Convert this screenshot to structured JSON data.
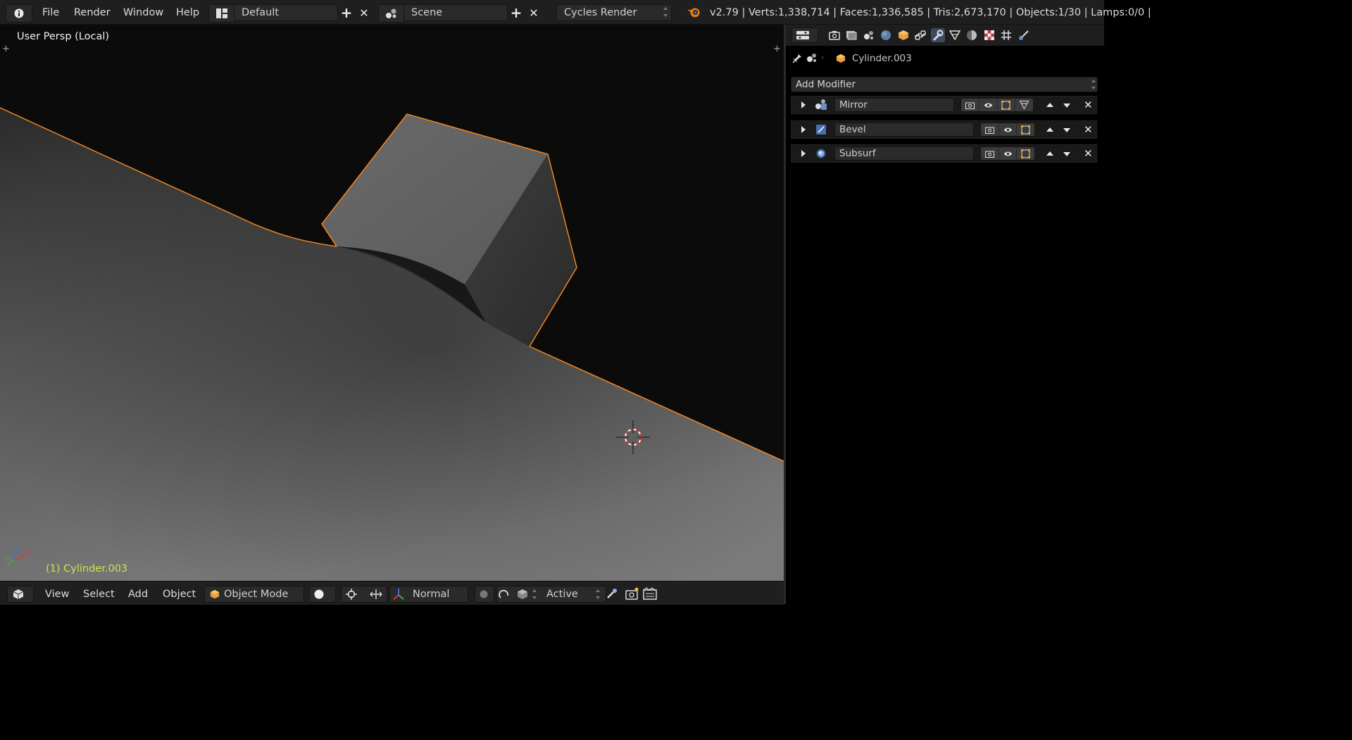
{
  "topbar": {
    "menu": [
      "File",
      "Render",
      "Window",
      "Help"
    ],
    "screen_layout": "Default",
    "scene": "Scene",
    "render_engine": "Cycles Render",
    "stats": "v2.79 | Verts:1,338,714 | Faces:1,336,585 | Tris:2,673,170 | Objects:1/30 | Lamps:0/0 |"
  },
  "viewport": {
    "view_name": "User Persp (Local)",
    "active_object": "(1) Cylinder.003",
    "axis": {
      "x": "X",
      "y": "Y",
      "z": "Z"
    },
    "colors": {
      "selection_outline": "#ff8a1c",
      "active_label": "#c8e64a"
    }
  },
  "properties": {
    "breadcrumb_object": "Cylinder.003",
    "add_modifier_label": "Add Modifier",
    "modifiers": [
      {
        "name": "Mirror",
        "icon": "mirror-modifier-icon"
      },
      {
        "name": "Bevel",
        "icon": "bevel-modifier-icon"
      },
      {
        "name": "Subsurf",
        "icon": "subsurf-modifier-icon"
      }
    ]
  },
  "bottombar": {
    "menu": [
      "View",
      "Select",
      "Add",
      "Object"
    ],
    "mode": "Object Mode",
    "transform_orientation": "Normal",
    "pivot": "Active"
  }
}
